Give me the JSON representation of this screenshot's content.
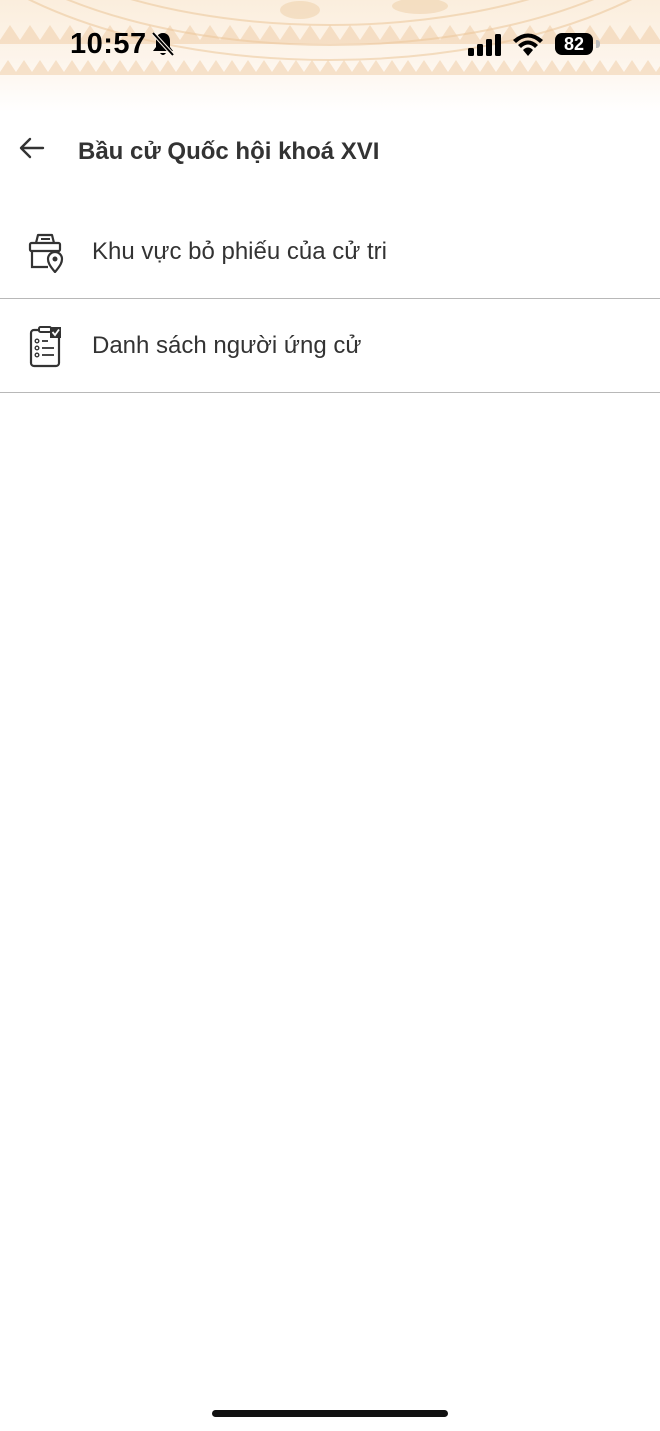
{
  "status_bar": {
    "time": "10:57",
    "battery": "82"
  },
  "nav": {
    "title": "Bầu cử Quốc hội khoá XVI"
  },
  "menu": {
    "items": [
      {
        "label": "Khu vực bỏ phiếu của cử tri",
        "icon": "ballot-box-location-icon"
      },
      {
        "label": "Danh sách người ứng cử",
        "icon": "candidate-checklist-icon"
      }
    ]
  },
  "colors": {
    "header_pattern": "#f3d9b5",
    "text": "#333333",
    "divider": "#b8b8b8"
  }
}
